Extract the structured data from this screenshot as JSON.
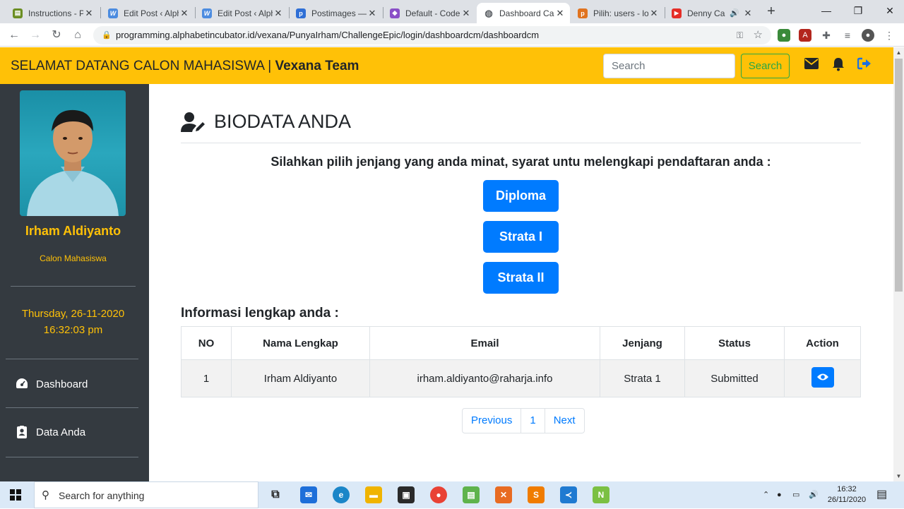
{
  "browser": {
    "tabs": [
      {
        "title": "Instructions - P",
        "icon": "instructions-favicon",
        "color": "#6b8e23"
      },
      {
        "title": "Edit Post ‹ Alph",
        "icon": "wordpress-favicon",
        "color": "#4c8ce0"
      },
      {
        "title": "Edit Post ‹ Alph",
        "icon": "wordpress-favicon",
        "color": "#4c8ce0"
      },
      {
        "title": "Postimages —",
        "icon": "postimages-favicon",
        "color": "#2f6fd6"
      },
      {
        "title": "Default - Code",
        "icon": "codepen-favicon",
        "color": "#8a4fc7"
      },
      {
        "title": "Dashboard Ca",
        "icon": "globe-favicon",
        "color": "#5f6368",
        "active": true
      },
      {
        "title": "Pilih: users - lo",
        "icon": "phpmyadmin-favicon",
        "color": "#e0731f"
      },
      {
        "title": "Denny Ca",
        "icon": "youtube-favicon",
        "color": "#e52d27"
      }
    ],
    "close_glyph": "✕",
    "new_tab": "+",
    "url": "programming.alphabetincubator.id/vexana/PunyaIrham/ChallengeEpic/login/dashboardcm/dashboardcm"
  },
  "header": {
    "welcome": "SELAMAT DATANG CALON MAHASISWA | ",
    "team": "Vexana Team",
    "search_placeholder": "Search",
    "search_button": "Search",
    "accent": "#ffc107"
  },
  "sidebar": {
    "name": "Irham Aldiyanto",
    "role": "Calon Mahasiswa",
    "date": "Thursday, 26-11-2020",
    "time": "16:32:03 pm",
    "items": [
      {
        "label": "Dashboard",
        "icon": "tachometer-icon"
      },
      {
        "label": "Data Anda",
        "icon": "id-card-icon"
      }
    ]
  },
  "main": {
    "title": "BIODATA ANDA",
    "instruction": "Silahkan pilih jenjang yang anda minat, syarat untu melengkapi pendaftaran anda :",
    "levels": [
      "Diploma",
      "Strata I",
      "Strata II"
    ],
    "info_heading": "Informasi lengkap anda :",
    "table": {
      "headers": [
        "NO",
        "Nama Lengkap",
        "Email",
        "Jenjang",
        "Status",
        "Action"
      ],
      "rows": [
        {
          "no": "1",
          "name": "Irham Aldiyanto",
          "email": "irham.aldiyanto@raharja.info",
          "level": "Strata 1",
          "status": "Submitted"
        }
      ]
    },
    "pagination": {
      "previous": "Previous",
      "page": "1",
      "next": "Next"
    },
    "button_color": "#007bff"
  },
  "taskbar": {
    "search_placeholder": "Search for anything",
    "time": "16:32",
    "date": "26/11/2020"
  }
}
